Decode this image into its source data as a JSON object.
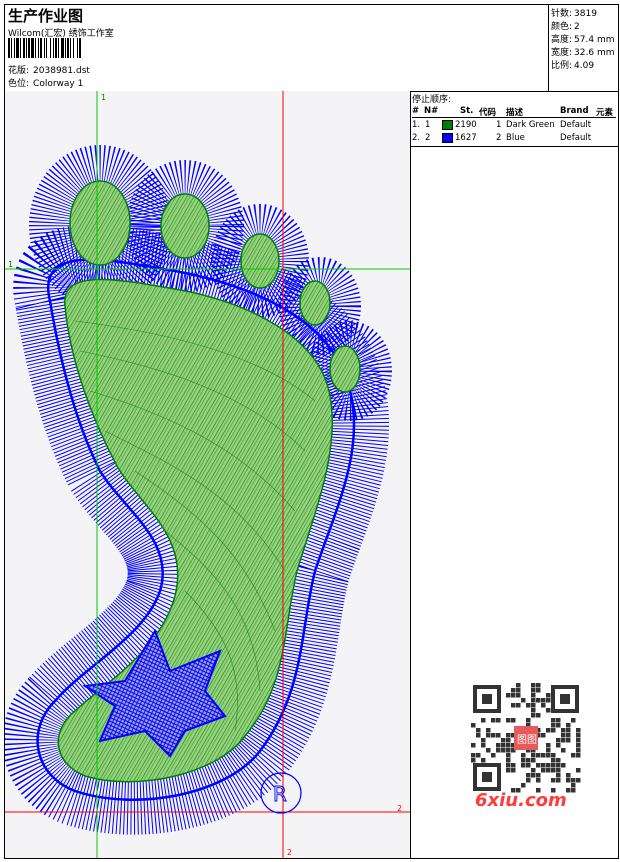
{
  "header": {
    "title": "生产作业图",
    "studio": "Wilcom(汇宏) 绣饰工作室",
    "design_label": "花版:",
    "design_value": "2038981.dst",
    "colorway_label": "色位:",
    "colorway_value": "Colorway 1"
  },
  "stats": [
    {
      "label": "针数:",
      "value": "3819"
    },
    {
      "label": "颜色:",
      "value": "2"
    },
    {
      "label": "高度:",
      "value": "57.4 mm"
    },
    {
      "label": "宽度:",
      "value": "32.6 mm"
    },
    {
      "label": "比例:",
      "value": "4.09"
    }
  ],
  "stop_sequence": {
    "title": "停止顺序:",
    "columns": [
      "#",
      "N#",
      "St.",
      "代码",
      "描述",
      "Brand",
      "元素"
    ],
    "rows": [
      {
        "num": "1.",
        "n": "1",
        "color": "#008000",
        "stitches": "2190",
        "code": "1",
        "desc": "Dark Green",
        "brand": "Default"
      },
      {
        "num": "2.",
        "n": "2",
        "color": "#0000ff",
        "stitches": "1627",
        "code": "2",
        "desc": "Blue",
        "brand": "Default"
      }
    ]
  },
  "canvas": {
    "green_axis_label_x": "1",
    "green_axis_label_y": "1",
    "red_axis_label_x": "2",
    "red_axis_label_y": "2",
    "origin_mark": "R",
    "colors": {
      "green": "#008000",
      "blue": "#0000ff",
      "red": "#ff0000",
      "fill_green": "#6abf4b"
    }
  },
  "watermark": {
    "text": "6xiu.com",
    "qr_center": "图图"
  }
}
